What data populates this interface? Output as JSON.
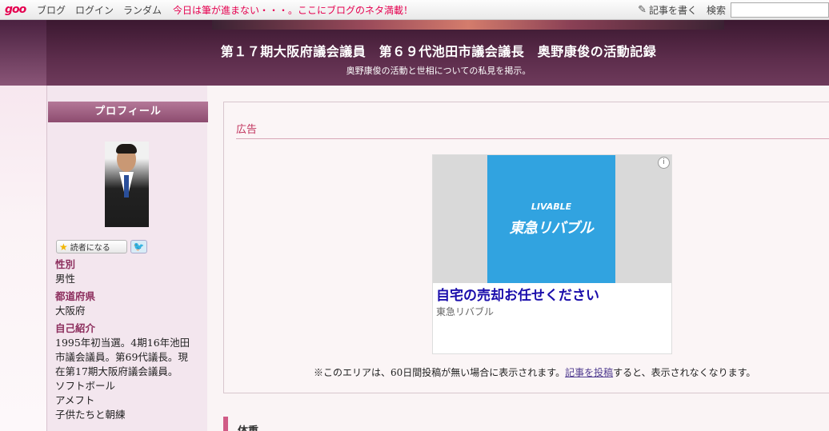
{
  "topbar": {
    "logo": "goo",
    "nav": [
      "ブログ",
      "ログイン",
      "ランダム"
    ],
    "notice": "今日は筆が進まない・・・。ここにブログのネタ満載！",
    "write_label": "記事を書く",
    "search_label": "検索",
    "search_value": ""
  },
  "header": {
    "title": "第１７期大阪府議会議員　第６９代池田市議会議長　奥野康俊の活動記録",
    "subtitle": "奥野康俊の活動と世相についての私見を掲示。"
  },
  "sidebar": {
    "heading": "プロフィール",
    "reader_button": "読者になる",
    "fields": [
      {
        "label": "性別",
        "value": "男性"
      },
      {
        "label": "都道府県",
        "value": "大阪府"
      },
      {
        "label": "自己紹介",
        "value": "1995年初当選。4期16年池田市議会議員。第69代議長。現在第17期大阪府議会議員。ソフトボールアメフト子供たちと朝練"
      }
    ],
    "intro_lines": [
      "1995年初当選。4期16年池田",
      "市議会議員。第69代議長。現",
      "在第17期大阪府議会議員。",
      "ソフトボール",
      "アメフト",
      "子供たちと朝練"
    ]
  },
  "ad": {
    "heading": "広告",
    "brand_top": "LIVABLE",
    "brand": "東急リバブル",
    "title": "自宅の売却お任せください",
    "advertiser": "東急リバブル",
    "note_before": "※このエリアは、60日間投稿が無い場合に表示されます。",
    "note_link": "記事を投稿",
    "note_after": "すると、表示されなくなります。"
  },
  "next_section": {
    "title": "体重"
  },
  "colors": {
    "accent": "#e5004f",
    "header_bg": "#5d2d4c",
    "sidebar_label": "#8d2f5e",
    "ad_blue": "#31a3e0"
  }
}
